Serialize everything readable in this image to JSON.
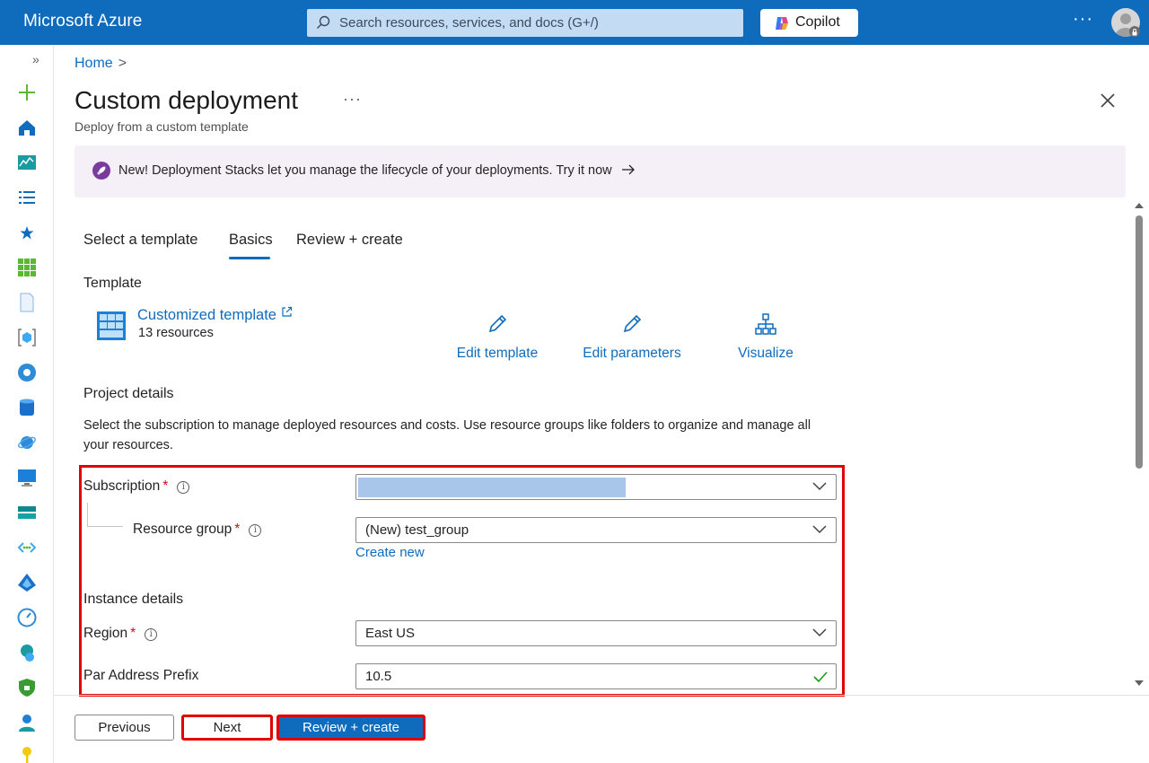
{
  "topbar": {
    "brand": "Microsoft Azure",
    "search_placeholder": "Search resources, services, and docs (G+/)",
    "copilot_label": "Copilot",
    "more_label": "···"
  },
  "breadcrumb": {
    "home": "Home",
    "separator": ">"
  },
  "header": {
    "title": "Custom deployment",
    "more": "···",
    "subtitle": "Deploy from a custom template"
  },
  "banner": {
    "text": "New! Deployment Stacks let you manage the lifecycle of your deployments. Try it now"
  },
  "tabs": [
    {
      "label": "Select a template",
      "active": false
    },
    {
      "label": "Basics",
      "active": true
    },
    {
      "label": "Review + create",
      "active": false
    }
  ],
  "template": {
    "heading": "Template",
    "name": "Customized template",
    "count": "13 resources",
    "actions": {
      "edit_template": "Edit template",
      "edit_parameters": "Edit parameters",
      "visualize": "Visualize"
    }
  },
  "project": {
    "heading": "Project details",
    "description": "Select the subscription to manage deployed resources and costs. Use resource groups like folders to organize and manage all your resources.",
    "subscription_label": "Subscription",
    "subscription_value": "",
    "resource_group_label": "Resource group",
    "resource_group_value": "(New) test_group",
    "create_new": "Create new",
    "required_mark": "*",
    "info_mark": "i"
  },
  "instance": {
    "heading": "Instance details",
    "region_label": "Region",
    "region_value": "East US",
    "prefix_label": "Par Address Prefix",
    "prefix_value": "10.5"
  },
  "footer": {
    "previous": "Previous",
    "next": "Next",
    "review_create": "Review + create"
  },
  "colors": {
    "accent": "#0f6cbd",
    "highlight_box": "#e00000",
    "valid_check": "#13a10e"
  }
}
